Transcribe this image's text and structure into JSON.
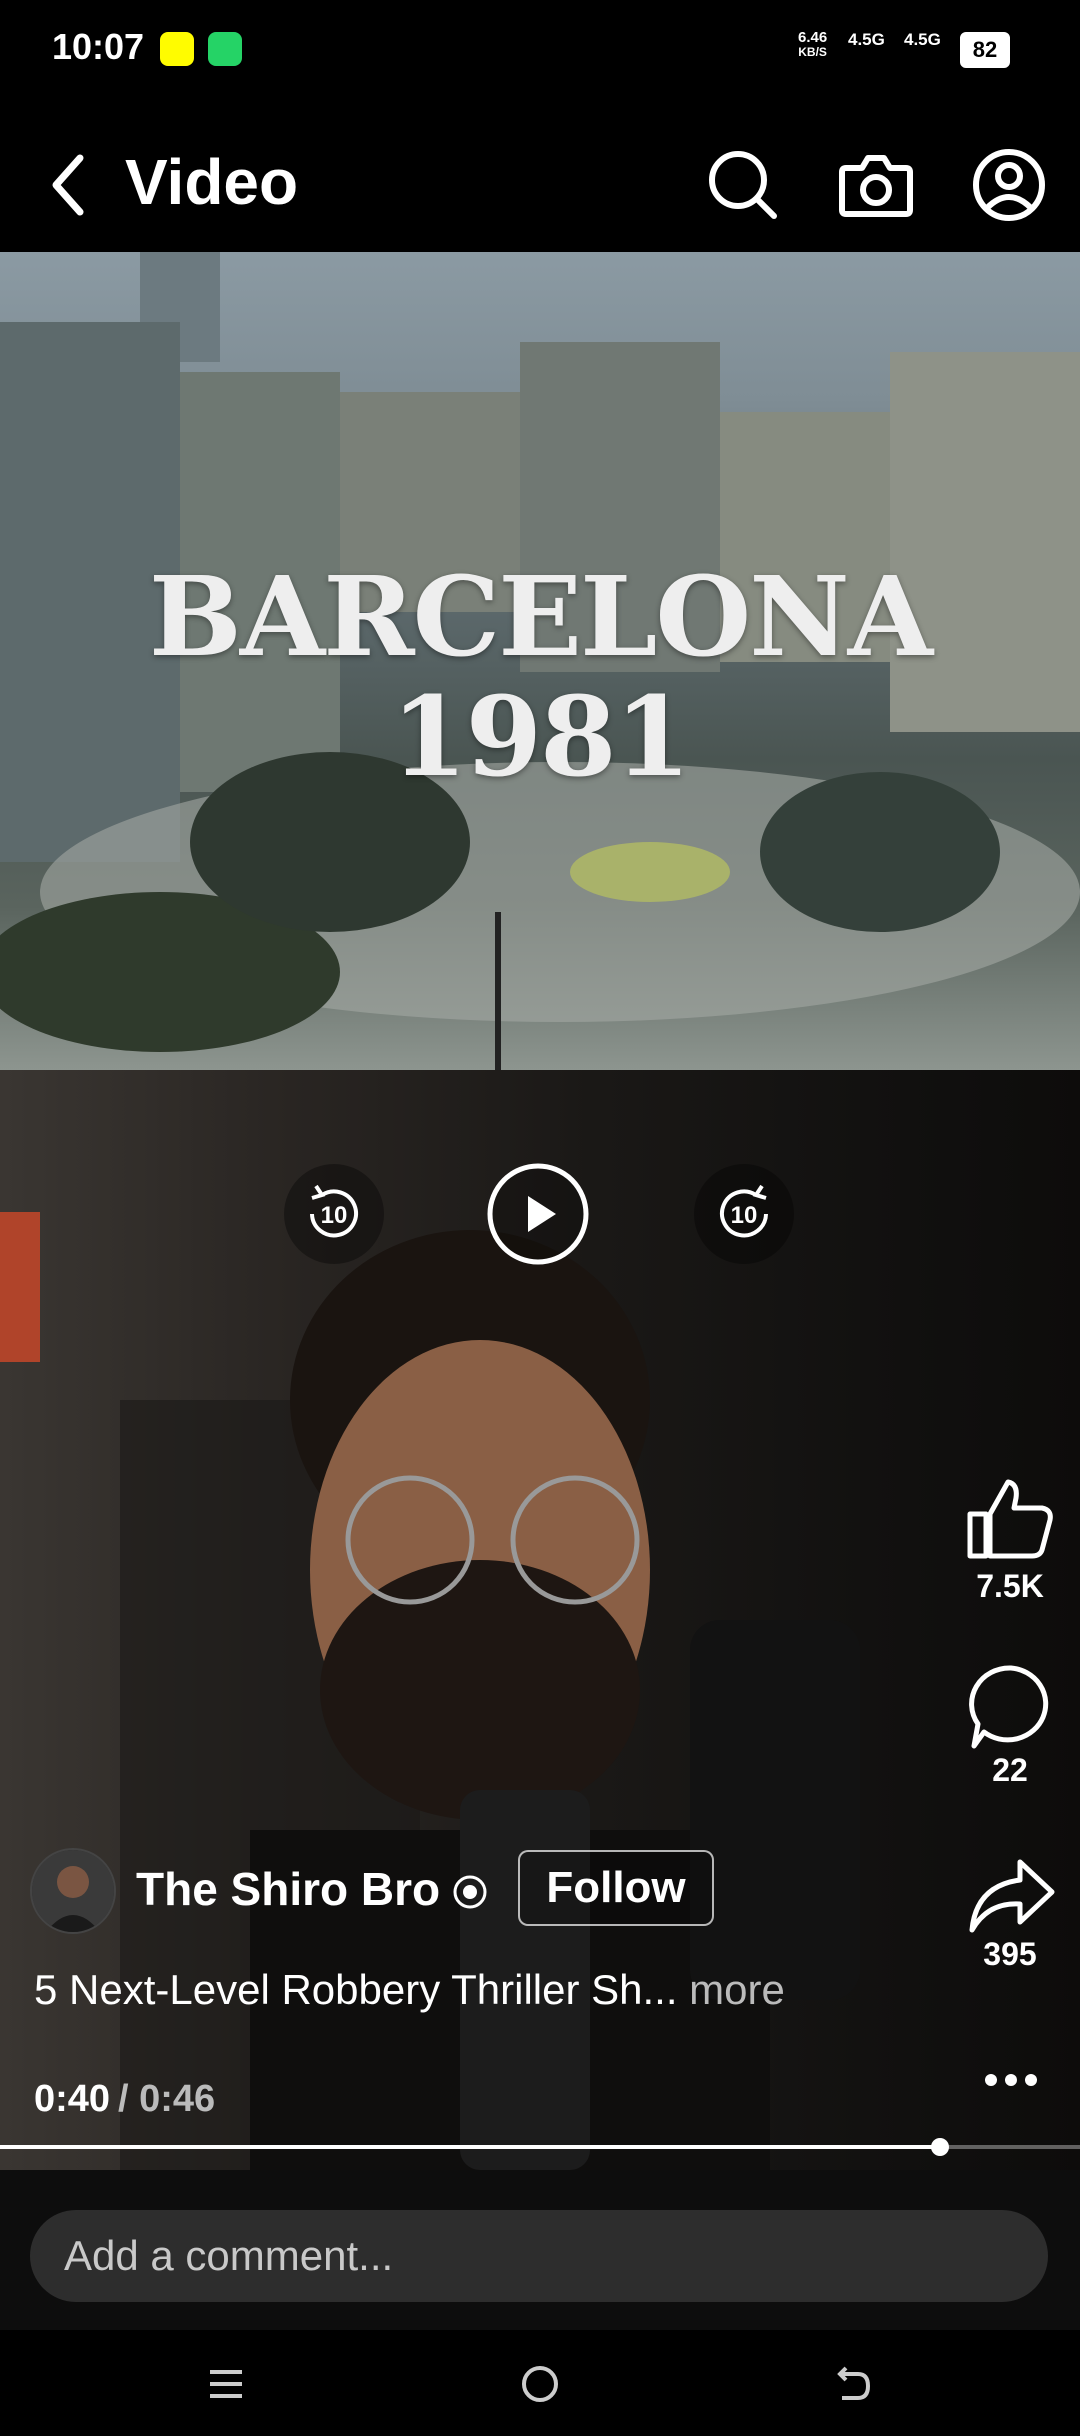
{
  "status_bar": {
    "time": "10:07",
    "net_speed_value": "6.46",
    "net_speed_unit": "KB/S",
    "sim1": "4.5G",
    "sim2": "4.5G",
    "battery": "82"
  },
  "header": {
    "title": "Video",
    "icons": [
      "back-icon",
      "search-icon",
      "camera-icon",
      "profile-icon"
    ]
  },
  "video": {
    "overlay_line1": "BARCELONA",
    "overlay_line2": "1981",
    "controls": [
      "replay-10-icon",
      "play-icon",
      "forward-10-icon"
    ],
    "likes": "7.5K",
    "comments": "22",
    "shares": "395",
    "channel_name": "The Shiro Bro",
    "follow_label": "Follow",
    "caption": "5 Next-Level Robbery Thriller Sh...",
    "more_label": "more",
    "current_time": "0:40",
    "total_time": "/ 0:46",
    "progress_fraction": 0.87
  },
  "comment": {
    "placeholder": "Add a comment..."
  },
  "colors": {
    "background": "#000000",
    "accent": "#ffffff",
    "comment_field": "#2d2d2d"
  }
}
